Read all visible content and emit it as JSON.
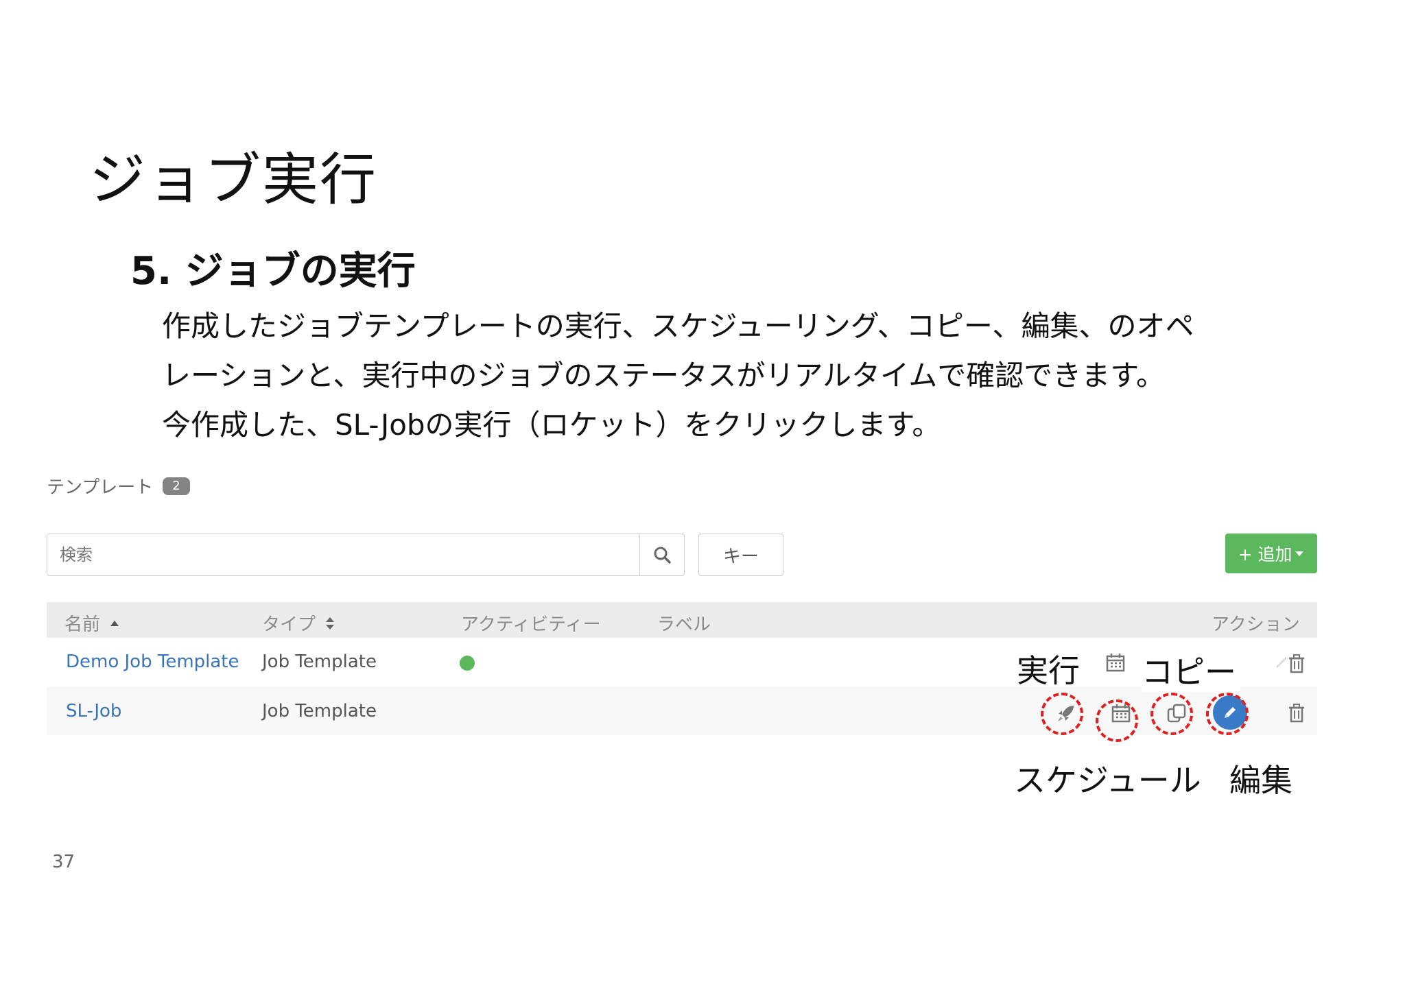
{
  "slide": {
    "title": "ジョブ実行",
    "section": "5. ジョブの実行",
    "body_lines": [
      "作成したジョブテンプレートの実行、スケジューリング、コピー、編集、のオペ",
      "レーションと、実行中のジョブのステータスがリアルタイムで確認できます。",
      "今作成した、SL-Jobの実行（ロケット）をクリックします。"
    ],
    "page_number": "37"
  },
  "ui": {
    "header_label": "テンプレート",
    "header_count": "2",
    "search_placeholder": "検索",
    "key_button_label": "キー",
    "add_button_label": "+ 追加",
    "columns": {
      "name": "名前",
      "type": "タイプ",
      "activity": "アクティビティー",
      "labels": "ラベル",
      "actions": "アクション"
    },
    "rows": [
      {
        "name": "Demo Job Template",
        "type": "Job Template"
      },
      {
        "name": "SL-Job",
        "type": "Job Template"
      }
    ]
  },
  "callouts": {
    "run": "実行",
    "copy": "コピー",
    "schedule": "スケジュール",
    "edit": "編集"
  },
  "colors": {
    "add_button": "#5cb85c",
    "status_ok": "#5cb85c",
    "link": "#3a74b8",
    "edit_icon": "#3a7bc8",
    "highlight_ring": "#e02020"
  }
}
